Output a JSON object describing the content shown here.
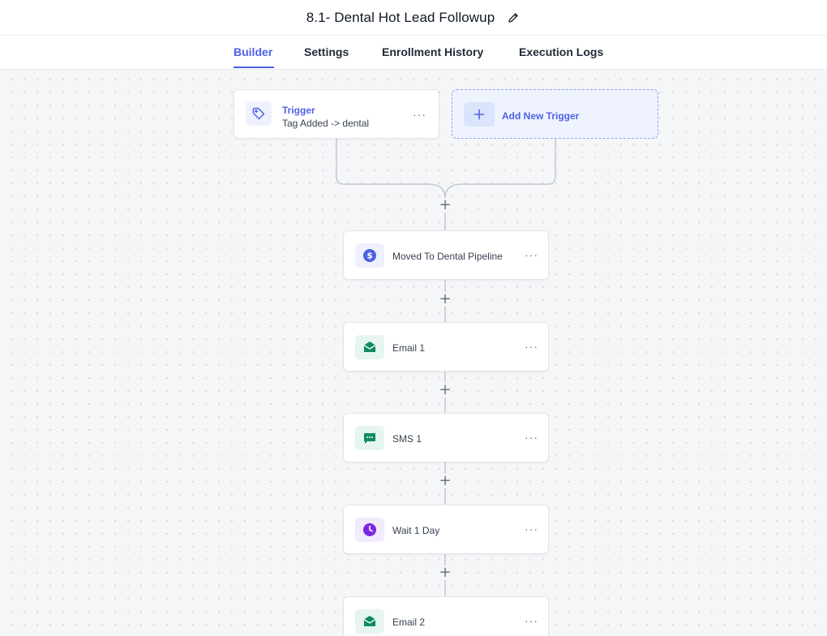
{
  "workflow": {
    "title": "8.1- Dental Hot Lead Followup",
    "edit_icon": "pencil-icon"
  },
  "tabs": [
    {
      "label": "Builder",
      "active": true
    },
    {
      "label": "Settings",
      "active": false
    },
    {
      "label": "Enrollment History",
      "active": false
    },
    {
      "label": "Execution Logs",
      "active": false
    }
  ],
  "trigger": {
    "title": "Trigger",
    "subtitle": "Tag Added -> dental",
    "icon": "tag-icon",
    "menu": "···"
  },
  "add_trigger": {
    "label": "Add New Trigger",
    "icon": "plus-icon"
  },
  "actions": [
    {
      "label": "Moved To Dental Pipeline",
      "icon": "dollar-icon",
      "color": "#4f5fe0",
      "bg": "#eef0fd",
      "menu": "···"
    },
    {
      "label": "Email 1",
      "icon": "email-icon",
      "color": "#0f8a5f",
      "bg": "#e6f5ee",
      "menu": "···"
    },
    {
      "label": "SMS 1",
      "icon": "sms-icon",
      "color": "#0f8a5f",
      "bg": "#e6f5ee",
      "menu": "···"
    },
    {
      "label": "Wait 1 Day",
      "icon": "clock-icon",
      "color": "#7c28e0",
      "bg": "#f2eafd",
      "menu": "···"
    },
    {
      "label": "Email 2",
      "icon": "email-icon",
      "color": "#0f8a5f",
      "bg": "#e6f5ee",
      "menu": "···"
    }
  ],
  "add_step_symbol": "+",
  "colors": {
    "accent": "#4f61e6",
    "connector": "#c3c7cf",
    "canvas_bg": "#f5f6f8"
  }
}
